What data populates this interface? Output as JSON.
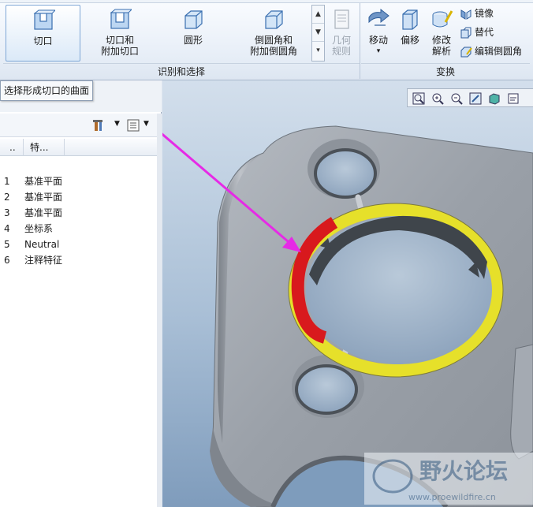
{
  "ribbon": {
    "buttons": {
      "cut": "切口",
      "cut_and_attached_line1": "切口和",
      "cut_and_attached_line2": "附加切口",
      "round": "圆形",
      "chamfer_line1": "倒圆角和",
      "chamfer_line2": "附加倒圆角",
      "geometry_rule_line1": "几何",
      "geometry_rule_line2": "规则",
      "move_label": "移动",
      "offset": "偏移",
      "modify_line1": "修改",
      "modify_line2": "解析",
      "mirror": "镜像",
      "substitute": "替代",
      "edit_round": "编辑倒圆角"
    },
    "groups": {
      "recognize_select": "识别和选择",
      "transform": "变换"
    }
  },
  "tooltip": "选择形成切口的曲面",
  "tree": {
    "header_dots": "..",
    "header_feature": "特...",
    "rows": [
      {
        "num": "1",
        "label": "基准平面"
      },
      {
        "num": "2",
        "label": "基准平面"
      },
      {
        "num": "3",
        "label": "基准平面"
      },
      {
        "num": "4",
        "label": "坐标系"
      },
      {
        "num": "5",
        "label": "Neutral"
      },
      {
        "num": "6",
        "label": "注释特征"
      }
    ]
  },
  "watermark": {
    "title": "野火论坛",
    "url": "www.proewildfire.cn"
  },
  "colors": {
    "selection_red": "#d8191d",
    "highlight_yellow": "#e6e02a",
    "annotation_magenta": "#e62ae6",
    "part_gray": "#9aa0a8"
  }
}
